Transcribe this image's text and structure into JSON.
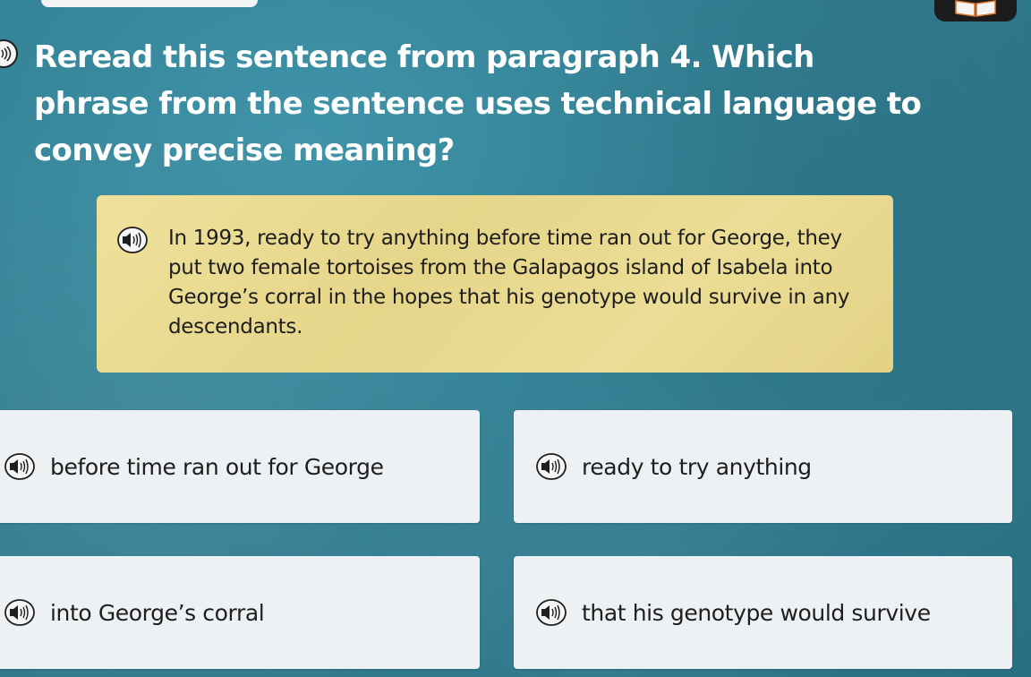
{
  "question": {
    "text": "Reread this sentence from paragraph 4. Which phrase from the sentence uses technical language to convey precise meaning?"
  },
  "passage": {
    "text": "In 1993, ready to try anything before time ran out for George, they put two female tortoises from the Galapagos island of Isabela into George’s corral in the hopes that his genotype would survive in any descendants."
  },
  "choices": [
    {
      "label": "before time ran out for George"
    },
    {
      "label": "ready to try anything"
    },
    {
      "label": "into George’s corral"
    },
    {
      "label": "that his genotype would survive"
    }
  ],
  "icons": {
    "audio": "speaker-icon",
    "book": "book-icon"
  },
  "colors": {
    "background": "#327f93",
    "passage_bg": "#ecdd96",
    "choice_bg": "#eef1f3",
    "question_text": "#ffffff"
  }
}
